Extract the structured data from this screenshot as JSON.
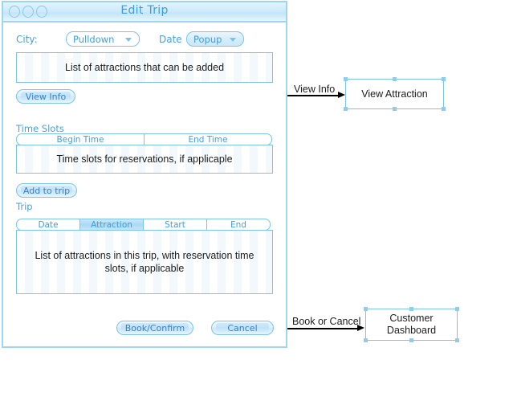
{
  "window": {
    "title": "Edit Trip",
    "controls": [
      "close-circle",
      "minimize-circle",
      "zoom-circle"
    ]
  },
  "form": {
    "city_label": "City:",
    "city_value": "Pulldown",
    "date_label": "Date",
    "date_value": "Popup"
  },
  "attractions": {
    "placeholder_text": "List of attractions that can be added",
    "view_info_button": "View Info"
  },
  "time_slots": {
    "section_label": "Time Slots",
    "columns": [
      "Begin Time",
      "End Time"
    ],
    "placeholder_text": "Time slots for reservations, if applicaple",
    "add_button": "Add to trip"
  },
  "trip": {
    "section_label": "Trip",
    "columns": [
      "Date",
      "Attraction",
      "Start",
      "End"
    ],
    "selected_column": "Attraction",
    "placeholder_text": "List of attractions in this trip, with reservation time slots, if applicable"
  },
  "actions": {
    "book_confirm": "Book/Confirm",
    "cancel": "Cancel"
  },
  "flow": {
    "view_info_transition": "View Info",
    "view_attraction_screen": "View Attraction",
    "book_cancel_transition": "Book or Cancel",
    "customer_dashboard_screen": "Customer\nDashboard",
    "customer_dashboard_line1": "Customer",
    "customer_dashboard_line2": "Dashboard"
  },
  "colors": {
    "accent_blue": "#45a3e0",
    "border_blue": "#7ec4ea",
    "titlebar_blue": "#d2ecfa",
    "selected_header": "#a9d9f4",
    "text_black": "#1c1c1c"
  }
}
